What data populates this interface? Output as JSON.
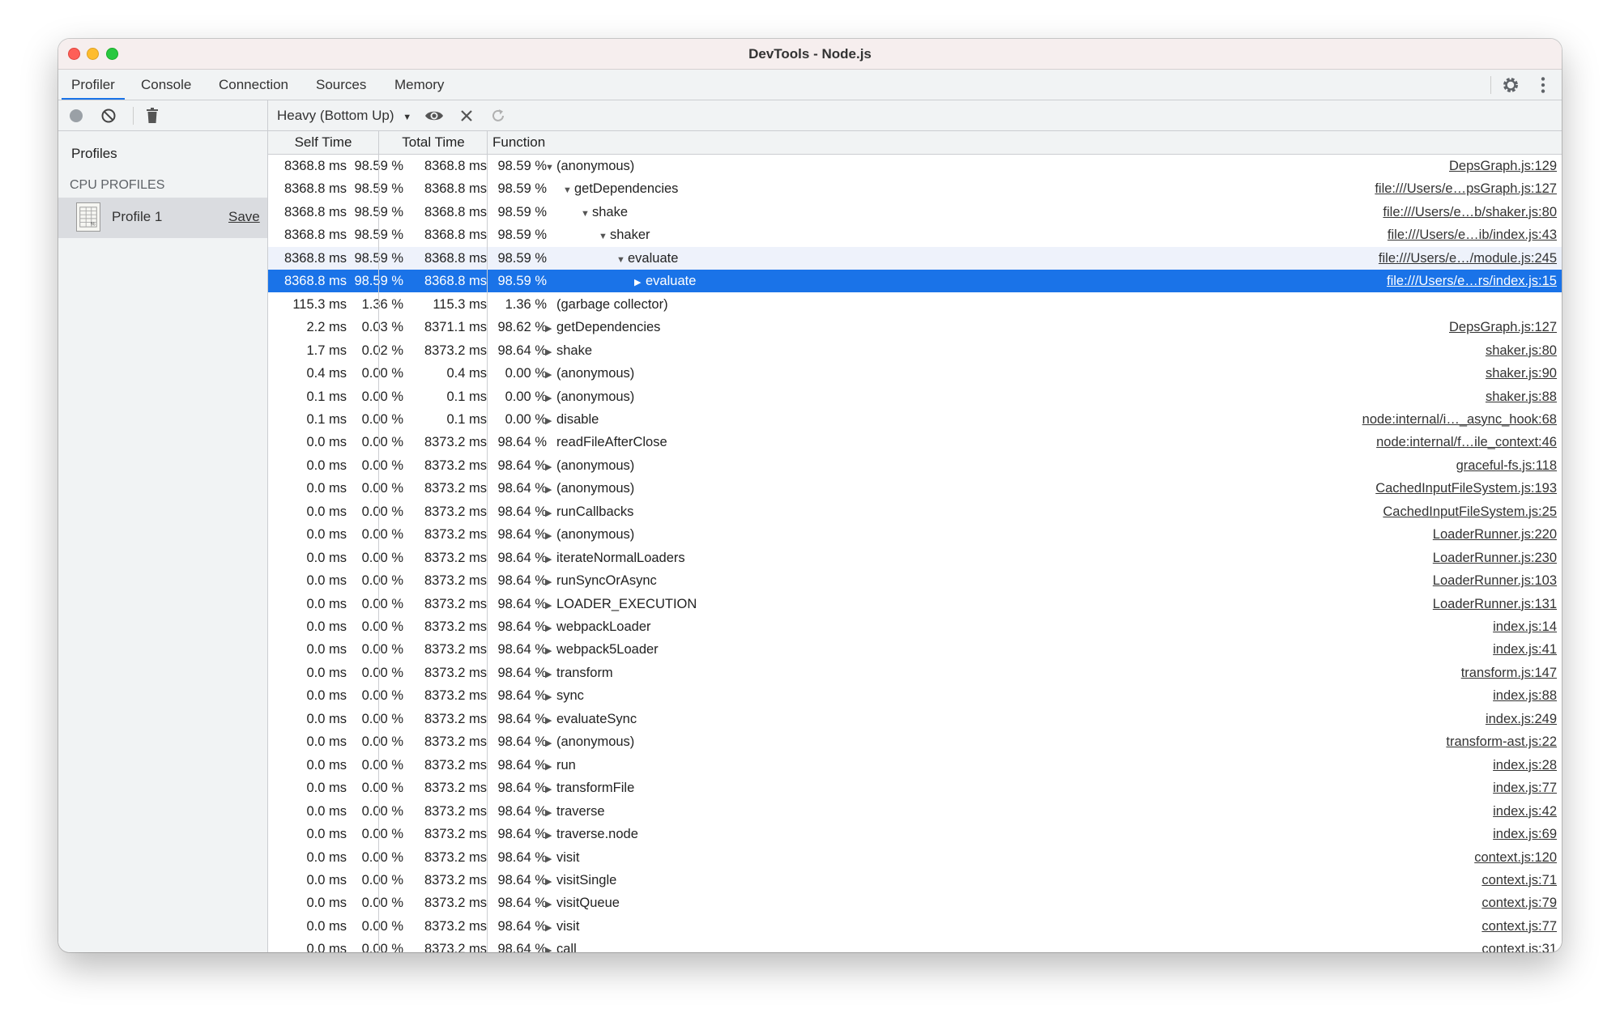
{
  "window": {
    "title": "DevTools - Node.js"
  },
  "tabs": [
    {
      "label": "Profiler",
      "active": true
    },
    {
      "label": "Console"
    },
    {
      "label": "Connection"
    },
    {
      "label": "Sources"
    },
    {
      "label": "Memory"
    }
  ],
  "toolbar": {
    "view_select": "Heavy (Bottom Up)"
  },
  "sidebar": {
    "heading": "Profiles",
    "section": "CPU PROFILES",
    "profile_name": "Profile 1",
    "save_label": "Save"
  },
  "columns": {
    "self": "Self Time",
    "total": "Total Time",
    "function": "Function"
  },
  "rows": [
    {
      "self_ms": "8368.8 ms",
      "self_pct": "98.59 %",
      "total_ms": "8368.8 ms",
      "total_pct": "98.59 %",
      "fn": "(anonymous)",
      "depth": 0,
      "tri": "down",
      "link": "DepsGraph.js:129"
    },
    {
      "self_ms": "8368.8 ms",
      "self_pct": "98.59 %",
      "total_ms": "8368.8 ms",
      "total_pct": "98.59 %",
      "fn": "getDependencies",
      "depth": 1,
      "tri": "down",
      "link": "file:///Users/e…psGraph.js:127"
    },
    {
      "self_ms": "8368.8 ms",
      "self_pct": "98.59 %",
      "total_ms": "8368.8 ms",
      "total_pct": "98.59 %",
      "fn": "shake",
      "depth": 2,
      "tri": "down",
      "link": "file:///Users/e…b/shaker.js:80"
    },
    {
      "self_ms": "8368.8 ms",
      "self_pct": "98.59 %",
      "total_ms": "8368.8 ms",
      "total_pct": "98.59 %",
      "fn": "shaker",
      "depth": 3,
      "tri": "down",
      "link": "file:///Users/e…ib/index.js:43"
    },
    {
      "self_ms": "8368.8 ms",
      "self_pct": "98.59 %",
      "total_ms": "8368.8 ms",
      "total_pct": "98.59 %",
      "fn": "evaluate",
      "depth": 4,
      "tri": "down",
      "link": "file:///Users/e…/module.js:245",
      "state": "hover"
    },
    {
      "self_ms": "8368.8 ms",
      "self_pct": "98.59 %",
      "total_ms": "8368.8 ms",
      "total_pct": "98.59 %",
      "fn": "evaluate",
      "depth": 5,
      "tri": "right",
      "link": "file:///Users/e…rs/index.js:15",
      "state": "selected"
    },
    {
      "self_ms": "115.3 ms",
      "self_pct": "1.36 %",
      "total_ms": "115.3 ms",
      "total_pct": "1.36 %",
      "fn": "(garbage collector)",
      "depth": 0,
      "tri": "none",
      "link": ""
    },
    {
      "self_ms": "2.2 ms",
      "self_pct": "0.03 %",
      "total_ms": "8371.1 ms",
      "total_pct": "98.62 %",
      "fn": "getDependencies",
      "depth": 0,
      "tri": "right",
      "link": "DepsGraph.js:127"
    },
    {
      "self_ms": "1.7 ms",
      "self_pct": "0.02 %",
      "total_ms": "8373.2 ms",
      "total_pct": "98.64 %",
      "fn": "shake",
      "depth": 0,
      "tri": "right",
      "link": "shaker.js:80"
    },
    {
      "self_ms": "0.4 ms",
      "self_pct": "0.00 %",
      "total_ms": "0.4 ms",
      "total_pct": "0.00 %",
      "fn": "(anonymous)",
      "depth": 0,
      "tri": "right",
      "link": "shaker.js:90"
    },
    {
      "self_ms": "0.1 ms",
      "self_pct": "0.00 %",
      "total_ms": "0.1 ms",
      "total_pct": "0.00 %",
      "fn": "(anonymous)",
      "depth": 0,
      "tri": "right",
      "link": "shaker.js:88"
    },
    {
      "self_ms": "0.1 ms",
      "self_pct": "0.00 %",
      "total_ms": "0.1 ms",
      "total_pct": "0.00 %",
      "fn": "disable",
      "depth": 0,
      "tri": "right",
      "link": "node:internal/i…_async_hook:68"
    },
    {
      "self_ms": "0.0 ms",
      "self_pct": "0.00 %",
      "total_ms": "8373.2 ms",
      "total_pct": "98.64 %",
      "fn": "readFileAfterClose",
      "depth": 0,
      "tri": "none",
      "link": "node:internal/f…ile_context:46"
    },
    {
      "self_ms": "0.0 ms",
      "self_pct": "0.00 %",
      "total_ms": "8373.2 ms",
      "total_pct": "98.64 %",
      "fn": "(anonymous)",
      "depth": 0,
      "tri": "right",
      "link": "graceful-fs.js:118"
    },
    {
      "self_ms": "0.0 ms",
      "self_pct": "0.00 %",
      "total_ms": "8373.2 ms",
      "total_pct": "98.64 %",
      "fn": "(anonymous)",
      "depth": 0,
      "tri": "right",
      "link": "CachedInputFileSystem.js:193"
    },
    {
      "self_ms": "0.0 ms",
      "self_pct": "0.00 %",
      "total_ms": "8373.2 ms",
      "total_pct": "98.64 %",
      "fn": "runCallbacks",
      "depth": 0,
      "tri": "right",
      "link": "CachedInputFileSystem.js:25"
    },
    {
      "self_ms": "0.0 ms",
      "self_pct": "0.00 %",
      "total_ms": "8373.2 ms",
      "total_pct": "98.64 %",
      "fn": "(anonymous)",
      "depth": 0,
      "tri": "right",
      "link": "LoaderRunner.js:220"
    },
    {
      "self_ms": "0.0 ms",
      "self_pct": "0.00 %",
      "total_ms": "8373.2 ms",
      "total_pct": "98.64 %",
      "fn": "iterateNormalLoaders",
      "depth": 0,
      "tri": "right",
      "link": "LoaderRunner.js:230"
    },
    {
      "self_ms": "0.0 ms",
      "self_pct": "0.00 %",
      "total_ms": "8373.2 ms",
      "total_pct": "98.64 %",
      "fn": "runSyncOrAsync",
      "depth": 0,
      "tri": "right",
      "link": "LoaderRunner.js:103"
    },
    {
      "self_ms": "0.0 ms",
      "self_pct": "0.00 %",
      "total_ms": "8373.2 ms",
      "total_pct": "98.64 %",
      "fn": "LOADER_EXECUTION",
      "depth": 0,
      "tri": "right",
      "link": "LoaderRunner.js:131"
    },
    {
      "self_ms": "0.0 ms",
      "self_pct": "0.00 %",
      "total_ms": "8373.2 ms",
      "total_pct": "98.64 %",
      "fn": "webpackLoader",
      "depth": 0,
      "tri": "right",
      "link": "index.js:14"
    },
    {
      "self_ms": "0.0 ms",
      "self_pct": "0.00 %",
      "total_ms": "8373.2 ms",
      "total_pct": "98.64 %",
      "fn": "webpack5Loader",
      "depth": 0,
      "tri": "right",
      "link": "index.js:41"
    },
    {
      "self_ms": "0.0 ms",
      "self_pct": "0.00 %",
      "total_ms": "8373.2 ms",
      "total_pct": "98.64 %",
      "fn": "transform",
      "depth": 0,
      "tri": "right",
      "link": "transform.js:147"
    },
    {
      "self_ms": "0.0 ms",
      "self_pct": "0.00 %",
      "total_ms": "8373.2 ms",
      "total_pct": "98.64 %",
      "fn": "sync",
      "depth": 0,
      "tri": "right",
      "link": "index.js:88"
    },
    {
      "self_ms": "0.0 ms",
      "self_pct": "0.00 %",
      "total_ms": "8373.2 ms",
      "total_pct": "98.64 %",
      "fn": "evaluateSync",
      "depth": 0,
      "tri": "right",
      "link": "index.js:249"
    },
    {
      "self_ms": "0.0 ms",
      "self_pct": "0.00 %",
      "total_ms": "8373.2 ms",
      "total_pct": "98.64 %",
      "fn": "(anonymous)",
      "depth": 0,
      "tri": "right",
      "link": "transform-ast.js:22"
    },
    {
      "self_ms": "0.0 ms",
      "self_pct": "0.00 %",
      "total_ms": "8373.2 ms",
      "total_pct": "98.64 %",
      "fn": "run",
      "depth": 0,
      "tri": "right",
      "link": "index.js:28"
    },
    {
      "self_ms": "0.0 ms",
      "self_pct": "0.00 %",
      "total_ms": "8373.2 ms",
      "total_pct": "98.64 %",
      "fn": "transformFile",
      "depth": 0,
      "tri": "right",
      "link": "index.js:77"
    },
    {
      "self_ms": "0.0 ms",
      "self_pct": "0.00 %",
      "total_ms": "8373.2 ms",
      "total_pct": "98.64 %",
      "fn": "traverse",
      "depth": 0,
      "tri": "right",
      "link": "index.js:42"
    },
    {
      "self_ms": "0.0 ms",
      "self_pct": "0.00 %",
      "total_ms": "8373.2 ms",
      "total_pct": "98.64 %",
      "fn": "traverse.node",
      "depth": 0,
      "tri": "right",
      "link": "index.js:69"
    },
    {
      "self_ms": "0.0 ms",
      "self_pct": "0.00 %",
      "total_ms": "8373.2 ms",
      "total_pct": "98.64 %",
      "fn": "visit",
      "depth": 0,
      "tri": "right",
      "link": "context.js:120"
    },
    {
      "self_ms": "0.0 ms",
      "self_pct": "0.00 %",
      "total_ms": "8373.2 ms",
      "total_pct": "98.64 %",
      "fn": "visitSingle",
      "depth": 0,
      "tri": "right",
      "link": "context.js:71"
    },
    {
      "self_ms": "0.0 ms",
      "self_pct": "0.00 %",
      "total_ms": "8373.2 ms",
      "total_pct": "98.64 %",
      "fn": "visitQueue",
      "depth": 0,
      "tri": "right",
      "link": "context.js:79"
    },
    {
      "self_ms": "0.0 ms",
      "self_pct": "0.00 %",
      "total_ms": "8373.2 ms",
      "total_pct": "98.64 %",
      "fn": "visit",
      "depth": 0,
      "tri": "right",
      "link": "context.js:77"
    },
    {
      "self_ms": "0.0 ms",
      "self_pct": "0.00 %",
      "total_ms": "8373.2 ms",
      "total_pct": "98.64 %",
      "fn": "call",
      "depth": 0,
      "tri": "right",
      "link": "context.js:31"
    }
  ]
}
